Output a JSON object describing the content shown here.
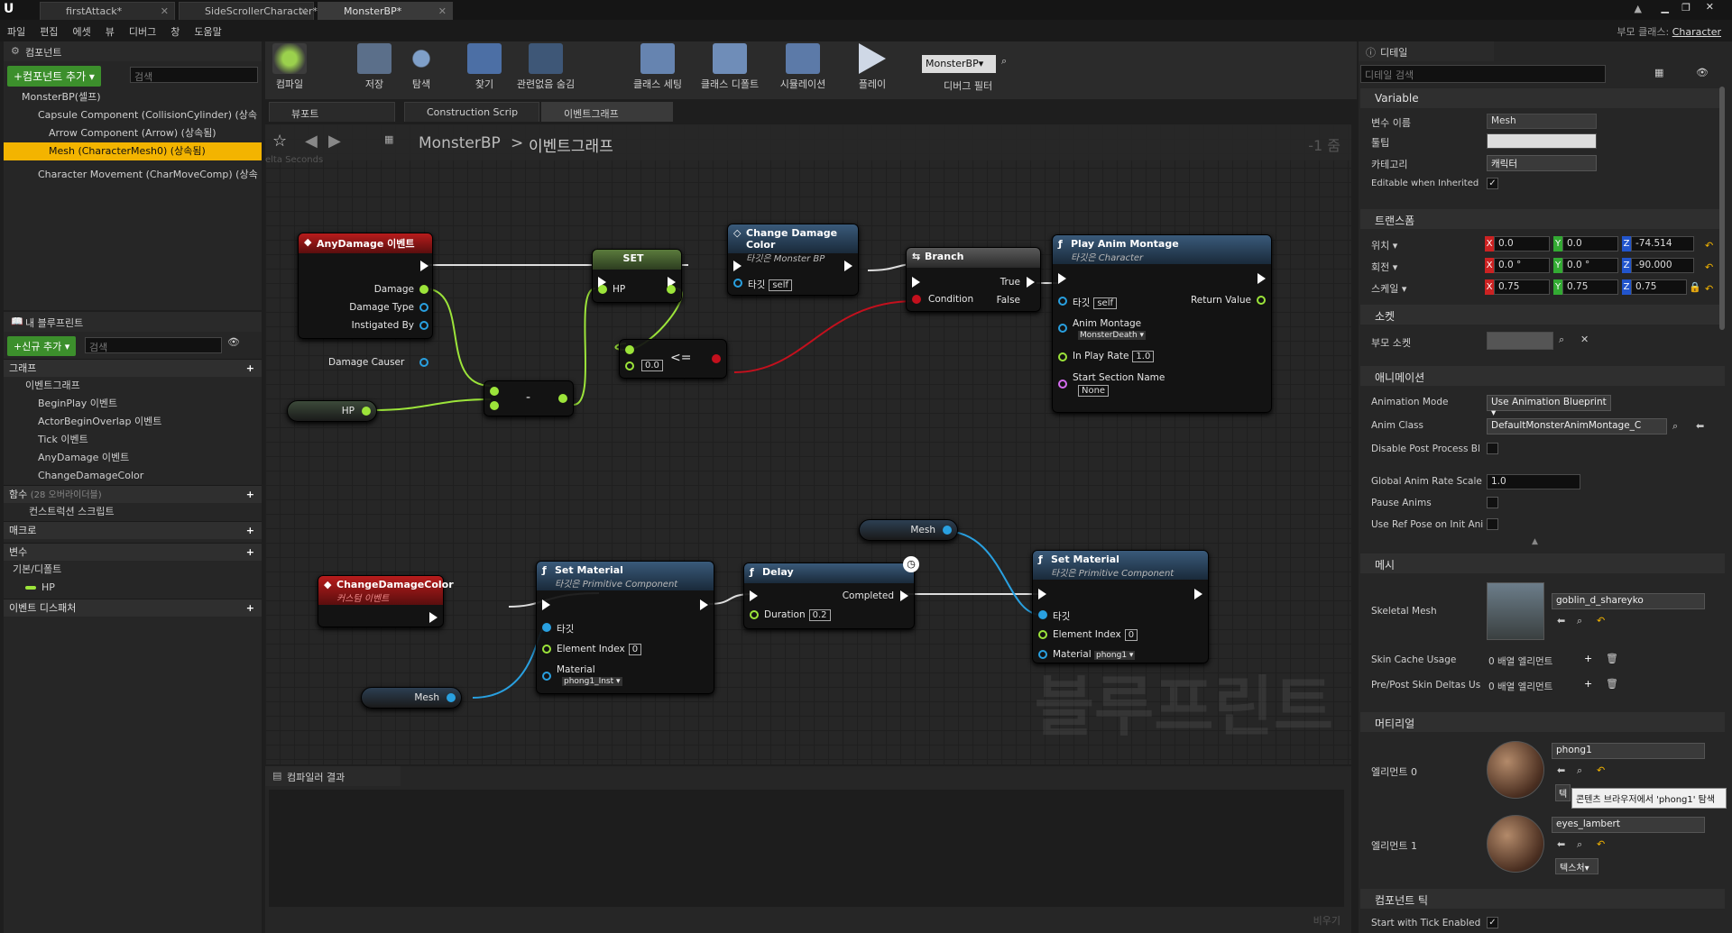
{
  "title_tabs": [
    {
      "label": "firstAttack*"
    },
    {
      "label": "SideScrollerCharacter*"
    },
    {
      "label": "MonsterBP*"
    }
  ],
  "parent_class": {
    "label": "부모 클래스:",
    "value": "Character"
  },
  "menu": [
    "파일",
    "편집",
    "에셋",
    "뷰",
    "디버그",
    "창",
    "도움말"
  ],
  "components": {
    "title": "컴포넌트",
    "add_button": "+컴포넌트 추가 ▾",
    "search_placeholder": "검색",
    "root": "MonsterBP(셀프)",
    "items": [
      "Capsule Component (CollisionCylinder) (상속",
      "Arrow Component (Arrow) (상속됨)",
      "Mesh (CharacterMesh0) (상속됨)",
      "Character Movement (CharMoveComp) (상속"
    ]
  },
  "my_blueprint": {
    "title": "내 블루프린트",
    "add_button": "+신규 추가 ▾",
    "search_placeholder": "검색",
    "graph_section": "그래프",
    "event_graph": "이벤트그래프",
    "events": [
      "BeginPlay 이벤트",
      "ActorBeginOverlap 이벤트",
      "Tick 이벤트",
      "AnyDamage 이벤트",
      "ChangeDamageColor"
    ],
    "functions_section": "함수",
    "functions_note": "(28 오버라이더블)",
    "construction_script": "컨스트럭션 스크립트",
    "macro_section": "매크로",
    "variables_section": "변수",
    "default_group": "기본/디폴트",
    "var_hp": "HP",
    "dispatcher_section": "이벤트 디스패처"
  },
  "toolbar": [
    {
      "label": "컴파일"
    },
    {
      "label": "저장"
    },
    {
      "label": "탐색"
    },
    {
      "label": "찾기"
    },
    {
      "label": "관련없음 숨김"
    },
    {
      "label": "클래스 세팅"
    },
    {
      "label": "클래스 디폴트"
    },
    {
      "label": "시뮬레이션"
    },
    {
      "label": "플레이"
    }
  ],
  "debug": {
    "selector": "MonsterBP▾",
    "label": "디버그 필터"
  },
  "graph_tabs": [
    "뷰포트",
    "Construction Scrip",
    "이벤트그래프"
  ],
  "breadcrumb": {
    "root": "MonsterBP",
    "sep": ">",
    "leaf": "이벤트그래프",
    "zoom": "-1 줌",
    "ghost": "elta Seconds"
  },
  "nodes": {
    "anydamage": {
      "title": "AnyDamage 이벤트",
      "pins": [
        "Damage",
        "Damage Type",
        "Instigated By",
        "Damage Causer"
      ]
    },
    "hp_get": "HP",
    "set": {
      "title": "SET",
      "pin": "HP"
    },
    "minus": "-",
    "compare": {
      "op": "<=",
      "value": "0.0"
    },
    "change_color_call": {
      "title": "Change Damage Color",
      "sub": "타깃은 Monster BP",
      "target": "타깃",
      "self": "self"
    },
    "branch": {
      "title": "Branch",
      "condition": "Condition",
      "true": "True",
      "false": "False"
    },
    "play_montage": {
      "title": "Play Anim Montage",
      "sub": "타깃은 Character",
      "target": "타깃",
      "self": "self",
      "return": "Return Value",
      "montage_label": "Anim Montage",
      "montage_value": "MonsterDeath ▾",
      "rate_label": "In Play Rate",
      "rate": "1.0",
      "section_label": "Start Section Name",
      "section": "None"
    },
    "change_color_event": {
      "title": "ChangeDamageColor",
      "sub": "커스텀 이벤트"
    },
    "set_material1": {
      "title": "Set Material",
      "sub": "타깃은 Primitive Component",
      "target": "타깃",
      "index_label": "Element Index",
      "index": "0",
      "material_label": "Material",
      "material": "phong1_Inst ▾"
    },
    "delay": {
      "title": "Delay",
      "completed": "Completed",
      "duration_label": "Duration",
      "duration": "0.2"
    },
    "mesh_get1": "Mesh",
    "mesh_get2": "Mesh",
    "set_material2": {
      "title": "Set Material",
      "sub": "타깃은 Primitive Component",
      "target": "타깃",
      "index_label": "Element Index",
      "index": "0",
      "material_label": "Material",
      "material": "phong1 ▾"
    }
  },
  "watermark": "블루프린트",
  "compiler": {
    "title": "컴파일러 결과",
    "clear": "비우기"
  },
  "details": {
    "title": "디테일",
    "search_placeholder": "디테일 검색",
    "variable_section": "Variable",
    "var_name_label": "변수 이름",
    "var_name": "Mesh",
    "tooltip_label": "툴팁",
    "tooltip": "",
    "category_label": "카테고리",
    "category": "캐릭터",
    "editable_label": "Editable when Inherited",
    "transform_section": "트랜스폼",
    "location_label": "위치 ▾",
    "location": [
      "0.0",
      "0.0",
      "-74.514"
    ],
    "rotation_label": "회전 ▾",
    "rotation": [
      "0.0 °",
      "0.0 °",
      "-90.000"
    ],
    "scale_label": "스케일 ▾",
    "scale": [
      "0.75",
      "0.75",
      "0.75"
    ],
    "socket_section": "소켓",
    "parent_socket_label": "부모 소켓",
    "anim_section": "애니메이션",
    "anim_mode_label": "Animation Mode",
    "anim_mode": "Use Animation Blueprint ▾",
    "anim_class_label": "Anim Class",
    "anim_class": "DefaultMonsterAnimMontage_C",
    "disable_pp_label": "Disable Post Process Bl",
    "global_rate_label": "Global Anim Rate Scale",
    "global_rate": "1.0",
    "pause_label": "Pause Anims",
    "ref_pose_label": "Use Ref Pose on Init Ani",
    "mesh_section": "메시",
    "skeletal_label": "Skeletal Mesh",
    "skeletal": "goblin_d_shareyko",
    "skin_cache_label": "Skin Cache Usage",
    "skin_cache": "0 배열 엘리먼트",
    "skin_deltas_label": "Pre/Post Skin Deltas Us",
    "skin_deltas": "0 배열 엘리먼트",
    "material_section": "머티리얼",
    "element0_label": "엘리먼트 0",
    "element0": "phong1",
    "element1_label": "엘리먼트 1",
    "element1": "eyes_lambert",
    "texture_btn": "텍스처▾",
    "tooltip_text": "콘텐츠 브라우저에서 'phong1' 탐색",
    "tick_section": "컴포넌트 틱",
    "tick_label": "Start with Tick Enabled"
  }
}
